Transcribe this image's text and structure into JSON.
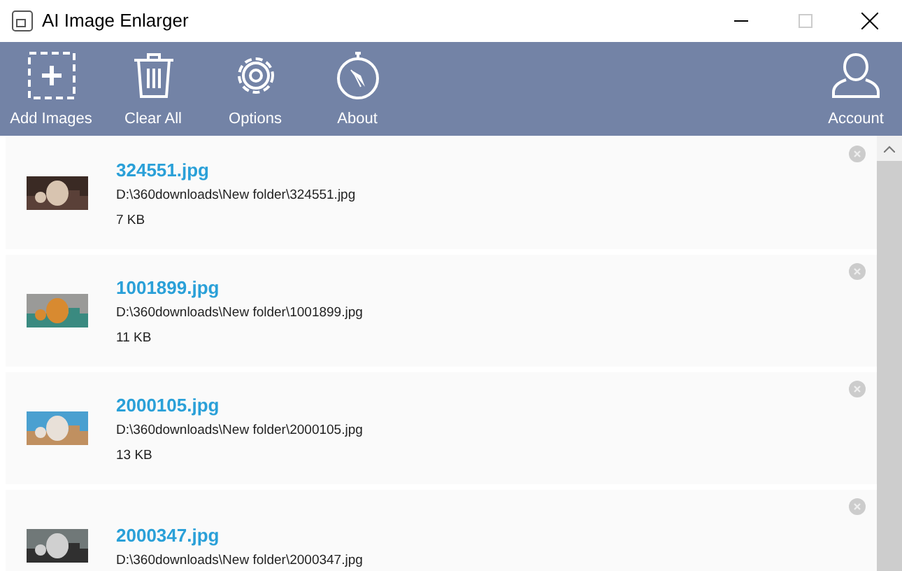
{
  "window": {
    "title": "AI Image Enlarger"
  },
  "toolbar": [
    {
      "kind": "add",
      "label": "Add Images"
    },
    {
      "kind": "clear",
      "label": "Clear All"
    },
    {
      "kind": "options",
      "label": "Options"
    },
    {
      "kind": "about",
      "label": "About"
    }
  ],
  "account": {
    "label": "Account"
  },
  "files": [
    {
      "name": "324551.jpg",
      "path": "D:\\360downloads\\New folder\\324551.jpg",
      "size": "7 KB"
    },
    {
      "name": "1001899.jpg",
      "path": "D:\\360downloads\\New folder\\1001899.jpg",
      "size": "11 KB"
    },
    {
      "name": "2000105.jpg",
      "path": "D:\\360downloads\\New folder\\2000105.jpg",
      "size": "13 KB"
    },
    {
      "name": "2000347.jpg",
      "path": "D:\\360downloads\\New folder\\2000347.jpg"
    }
  ]
}
